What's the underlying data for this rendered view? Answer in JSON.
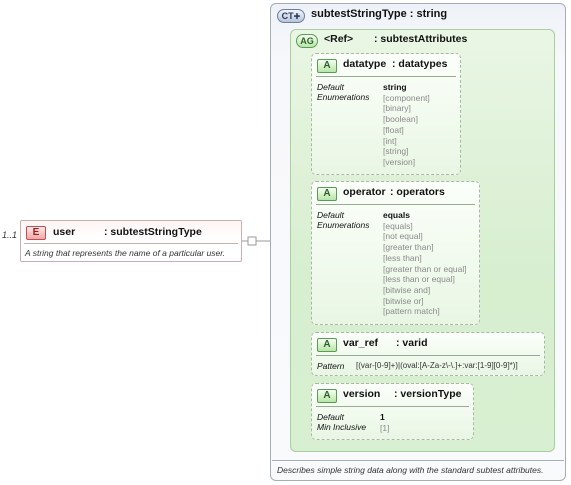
{
  "element": {
    "cardinality": "1..1",
    "badge": "E",
    "name": "user",
    "type": ": subtestStringType",
    "doc": "A string that represents the name of a particular user."
  },
  "complex_type": {
    "badge": "CT",
    "title": "subtestStringType : string",
    "doc": "Describes simple string data along with the standard subtest attributes."
  },
  "attribute_group": {
    "badge": "AG",
    "name": "<Ref>",
    "type": ": subtestAttributes"
  },
  "attributes": {
    "datatype": {
      "badge": "A",
      "name": "datatype",
      "type": ": datatypes",
      "default_label": "Default",
      "enum_label": "Enumerations",
      "default_value": "string",
      "enumerations": [
        "[component]",
        "[binary]",
        "[boolean]",
        "[float]",
        "[int]",
        "[string]",
        "[version]"
      ]
    },
    "operator": {
      "badge": "A",
      "name": "operator",
      "type": ": operators",
      "default_label": "Default",
      "enum_label": "Enumerations",
      "default_value": "equals",
      "enumerations": [
        "[equals]",
        "[not equal]",
        "[greater than]",
        "[less than]",
        "[greater than or equal]",
        "[less than or equal]",
        "[bitwise and]",
        "[bitwise or]",
        "[pattern match]"
      ]
    },
    "var_ref": {
      "badge": "A",
      "name": "var_ref",
      "type": ": varid",
      "pattern_label": "Pattern",
      "pattern_value": "[(var-[0-9]+)|(oval:[A-Za-z\\-\\.]+:var:[1-9][0-9]*)]"
    },
    "version": {
      "badge": "A",
      "name": "version",
      "type": ": versionType",
      "default_label": "Default",
      "min_label": "Min Inclusive",
      "default_value": "1",
      "min_value": "[1]"
    }
  }
}
